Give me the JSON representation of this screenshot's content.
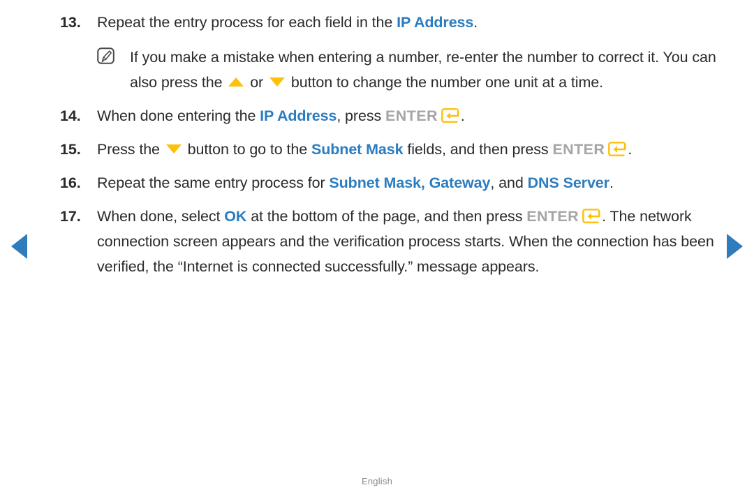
{
  "colors": {
    "text": "#2b2b2b",
    "link_blue": "#2b7cc0",
    "accent_yellow": "#fcc10a",
    "enter_gray": "#a6a6a6",
    "nav_blue": "#2e7cbc",
    "footer_gray": "#8a8a8a",
    "background": "#ffffff"
  },
  "footer": {
    "language": "English"
  },
  "nav": {
    "prev_label": "previous page",
    "next_label": "next page"
  },
  "icons": {
    "note": "note-pencil-icon",
    "enter": "enter-return-key-icon",
    "up": "up-arrow-button-icon",
    "down": "down-arrow-button-icon"
  },
  "steps": [
    {
      "number": "13.",
      "segments": [
        {
          "type": "text",
          "value": "Repeat the entry process for each field in the "
        },
        {
          "type": "blue",
          "value": "IP Address"
        },
        {
          "type": "text",
          "value": "."
        }
      ],
      "note": {
        "icon": "note-pencil-icon",
        "segments": [
          {
            "type": "text",
            "value": "If you make a mistake when entering a number, re-enter the number to correct it. You can also press the "
          },
          {
            "type": "icon-up",
            "value": "▲"
          },
          {
            "type": "text",
            "value": " or "
          },
          {
            "type": "icon-down",
            "value": "▼"
          },
          {
            "type": "text",
            "value": " button to change the number one unit at a time."
          }
        ]
      }
    },
    {
      "number": "14.",
      "segments": [
        {
          "type": "text",
          "value": "When done entering the "
        },
        {
          "type": "blue",
          "value": "IP Address"
        },
        {
          "type": "text",
          "value": ", press "
        },
        {
          "type": "enter-word",
          "value": "ENTER"
        },
        {
          "type": "icon-enter",
          "value": "↵"
        },
        {
          "type": "text",
          "value": "."
        }
      ]
    },
    {
      "number": "15.",
      "segments": [
        {
          "type": "text",
          "value": "Press the "
        },
        {
          "type": "icon-down",
          "value": "▼"
        },
        {
          "type": "text",
          "value": " button to go to the "
        },
        {
          "type": "blue",
          "value": "Subnet Mask"
        },
        {
          "type": "text",
          "value": " fields, and then press "
        },
        {
          "type": "enter-word",
          "value": "ENTER"
        },
        {
          "type": "icon-enter",
          "value": "↵"
        },
        {
          "type": "text",
          "value": "."
        }
      ]
    },
    {
      "number": "16.",
      "segments": [
        {
          "type": "text",
          "value": "Repeat the same entry process for "
        },
        {
          "type": "blue",
          "value": "Subnet Mask, Gateway"
        },
        {
          "type": "text",
          "value": ", and "
        },
        {
          "type": "blue",
          "value": "DNS Server"
        },
        {
          "type": "text",
          "value": "."
        }
      ]
    },
    {
      "number": "17.",
      "segments": [
        {
          "type": "text",
          "value": "When done, select "
        },
        {
          "type": "blue",
          "value": "OK"
        },
        {
          "type": "text",
          "value": " at the bottom of the page, and then press "
        },
        {
          "type": "enter-word",
          "value": "ENTER"
        },
        {
          "type": "icon-enter",
          "value": "↵"
        },
        {
          "type": "text",
          "value": ". The network connection screen appears and the verification process starts. When the connection has been verified, the “Internet is connected successfully.” message appears."
        }
      ]
    }
  ]
}
